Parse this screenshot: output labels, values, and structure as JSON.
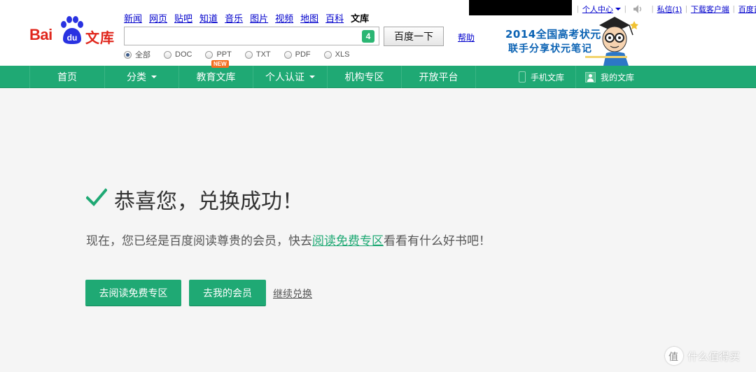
{
  "logo": {
    "bai": "Bai",
    "du": "du",
    "wenku": "文库"
  },
  "top_nav": {
    "items": [
      "新闻",
      "网页",
      "贴吧",
      "知道",
      "音乐",
      "图片",
      "视频",
      "地图",
      "百科"
    ],
    "active": "文库"
  },
  "search": {
    "value": "",
    "badge": "4",
    "button_label": "百度一下",
    "help_label": "帮助",
    "filters": [
      "全部",
      "DOC",
      "PPT",
      "TXT",
      "PDF",
      "XLS"
    ],
    "selected_filter": "全部"
  },
  "user_bar": {
    "personal_center": "个人中心",
    "messages": "私信",
    "messages_count": "(1)",
    "download_client": "下载客户端",
    "baidu_home": "百度首页"
  },
  "promo": {
    "line1": "2014全国高考状元",
    "line2": "联手分享状元笔记"
  },
  "main_nav": {
    "items": [
      "首页",
      "分类",
      "教育文库",
      "个人认证",
      "机构专区",
      "开放平台"
    ],
    "new_tag": "NEW",
    "mobile": "手机文库",
    "my_library": "我的文库"
  },
  "content": {
    "title": "恭喜您，兑换成功！",
    "message_before": "现在，您已经是百度阅读尊贵的会员，快去",
    "message_link": "阅读免费专区",
    "message_after": "看看有什么好书吧！",
    "btn_read_free": "去阅读免费专区",
    "btn_my_membership": "去我的会员",
    "link_continue": "继续兑换"
  },
  "watermark": {
    "text": "什么值得买"
  },
  "colors": {
    "accent_green": "#1fa974",
    "baidu_red": "#e0261c",
    "baidu_blue": "#2932e1",
    "link_blue": "#0000cc"
  }
}
